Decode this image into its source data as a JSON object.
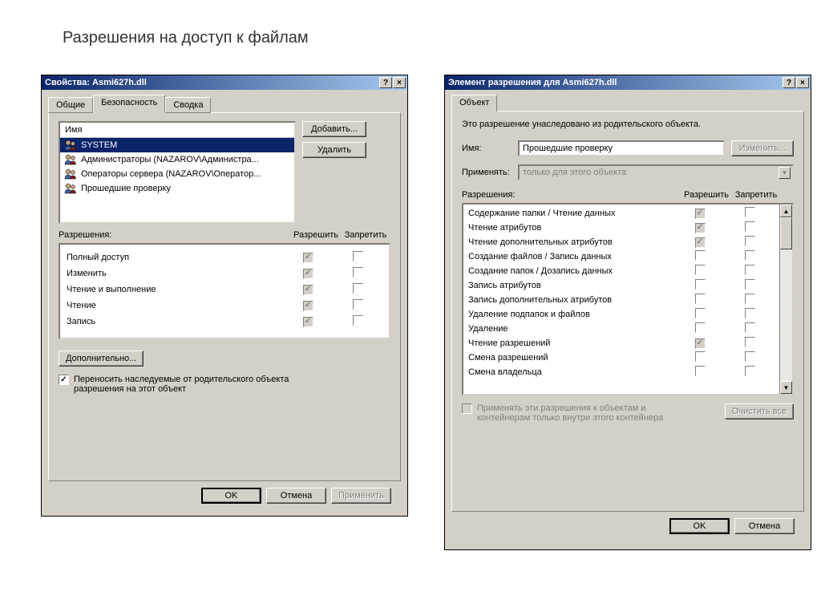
{
  "page_title": "Разрешения на доступ к  файлам",
  "left": {
    "title": "Свойства: Asmi627h.dll",
    "tabs": [
      "Общие",
      "Безопасность",
      "Сводка"
    ],
    "active_tab": 1,
    "list_header": "Имя",
    "users": [
      {
        "label": "SYSTEM",
        "selected": true
      },
      {
        "label": "Администраторы (NAZAROV\\Администра...",
        "selected": false
      },
      {
        "label": "Операторы сервера (NAZAROV\\Оператор...",
        "selected": false
      },
      {
        "label": "Прошедшие проверку",
        "selected": false
      }
    ],
    "btn_add": "Добавить...",
    "btn_remove": "Удалить",
    "perm_label": "Разрешения:",
    "col_allow": "Разрешить",
    "col_deny": "Запретить",
    "perms": [
      {
        "label": "Полный доступ",
        "allow": "checked-gray",
        "deny": ""
      },
      {
        "label": "Изменить",
        "allow": "checked-gray",
        "deny": ""
      },
      {
        "label": "Чтение и выполнение",
        "allow": "checked-gray",
        "deny": ""
      },
      {
        "label": "Чтение",
        "allow": "checked-gray",
        "deny": ""
      },
      {
        "label": "Запись",
        "allow": "checked-gray",
        "deny": ""
      }
    ],
    "btn_advanced": "Дополнительно...",
    "inherit_label": "Переносить наследуемые от родительского объекта разрешения на этот объект",
    "btn_ok": "OK",
    "btn_cancel": "Отмена",
    "btn_apply": "Применить"
  },
  "right": {
    "title": "Элемент разрешения для Asmi627h.dll",
    "tab": "Объект",
    "info": "Это разрешение унаследовано из родительского объекта.",
    "name_label": "Имя:",
    "name_value": "Прошедшие проверку",
    "btn_change": "Изменить...",
    "apply_label": "Применять:",
    "apply_value": "только для этого объекта",
    "perm_label": "Разрешения:",
    "col_allow": "Разрешить",
    "col_deny": "Запретить",
    "perms": [
      {
        "label": "Содержание папки / Чтение данных",
        "allow": "checked-gray",
        "deny": ""
      },
      {
        "label": "Чтение атрибутов",
        "allow": "checked-gray",
        "deny": ""
      },
      {
        "label": "Чтение дополнительных атрибутов",
        "allow": "checked-gray",
        "deny": ""
      },
      {
        "label": "Создание файлов / Запись данных",
        "allow": "",
        "deny": ""
      },
      {
        "label": "Создание папок / Дозапись данных",
        "allow": "",
        "deny": ""
      },
      {
        "label": "Запись атрибутов",
        "allow": "",
        "deny": ""
      },
      {
        "label": "Запись дополнительных атрибутов",
        "allow": "",
        "deny": ""
      },
      {
        "label": "Удаление подпапок и файлов",
        "allow": "",
        "deny": ""
      },
      {
        "label": "Удаление",
        "allow": "",
        "deny": ""
      },
      {
        "label": "Чтение разрешений",
        "allow": "checked-gray",
        "deny": ""
      },
      {
        "label": "Смена разрешений",
        "allow": "",
        "deny": ""
      },
      {
        "label": "Смена владельца",
        "allow": "",
        "deny": ""
      }
    ],
    "propagate_label": "Применять эти разрешения к объектам и контейнерам только внутри этого контейнера",
    "btn_clear": "Очистить все",
    "btn_ok": "OK",
    "btn_cancel": "Отмена"
  }
}
